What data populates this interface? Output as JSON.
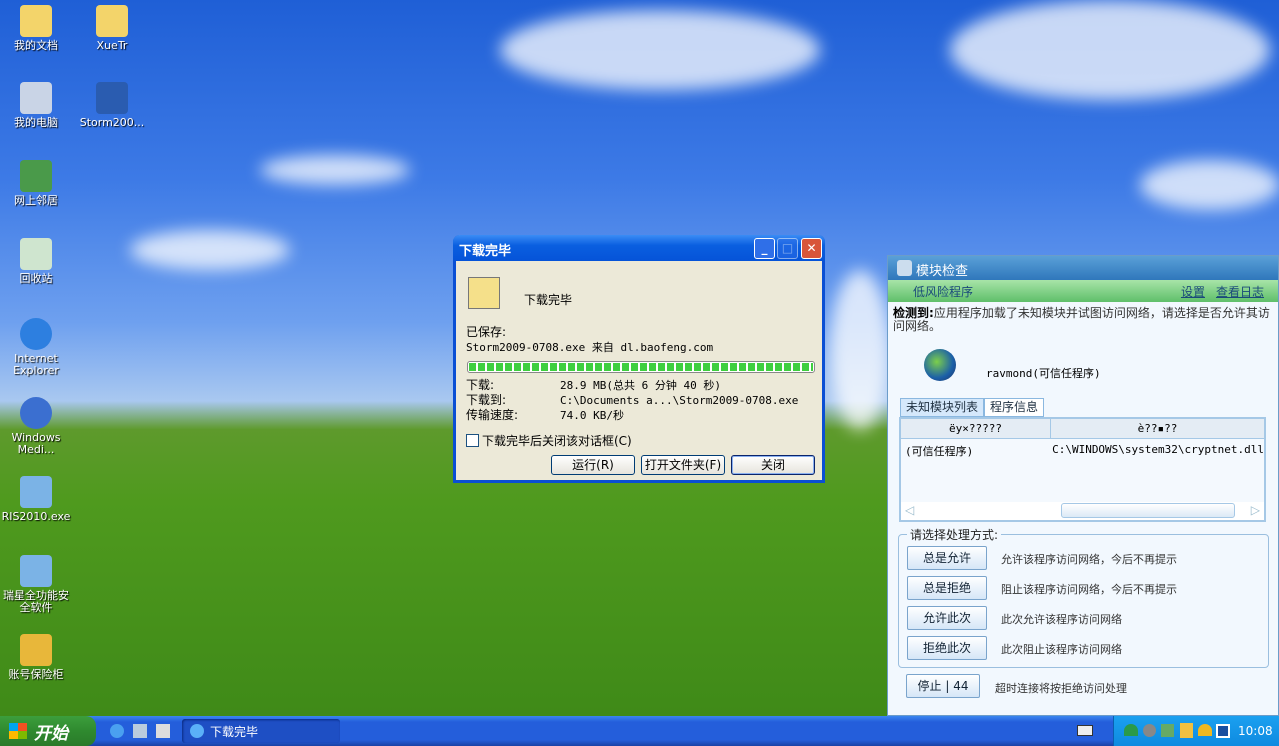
{
  "desktop": {
    "icons": [
      {
        "label": "我的文档"
      },
      {
        "label": "XueTr"
      },
      {
        "label": "我的电脑"
      },
      {
        "label": "Storm200..."
      },
      {
        "label": "网上邻居"
      },
      {
        "label": "回收站"
      },
      {
        "label": "Internet Explorer"
      },
      {
        "label": "Windows Medi..."
      },
      {
        "label": "RIS2010.exe"
      },
      {
        "label": "瑞星全功能安全软件"
      },
      {
        "label": "账号保险柜"
      }
    ]
  },
  "download": {
    "title": "下载完毕",
    "heading": "下载完毕",
    "saved_label": "已保存:",
    "saved_value": "Storm2009-0708.exe 来自 dl.baofeng.com",
    "progress": 100,
    "rows": [
      {
        "k": "下载:",
        "v": "28.9 MB(总共 6 分钟 40 秒)"
      },
      {
        "k": "下载到:",
        "v": "C:\\Documents a...\\Storm2009-0708.exe"
      },
      {
        "k": "传输速度:",
        "v": "74.0 KB/秒"
      }
    ],
    "checkbox": "下载完毕后关闭该对话框(C)",
    "run": "运行(R)",
    "open_folder": "打开文件夹(F)",
    "close": "关闭"
  },
  "module": {
    "title": "模块检查",
    "risk": "低风险程序",
    "settings": "设置",
    "log": "查看日志",
    "detect_label": "检测到:",
    "detect_text": "应用程序加载了未知模块并试图访问网络，请选择是否允许其访问网络。",
    "program": "ravmond(可信任程序)",
    "tabs": [
      "未知模块列表",
      "程序信息"
    ],
    "columns": [
      "ëy×?????",
      "è??▪??"
    ],
    "row": [
      "(可信任程序)",
      "C:\\WINDOWS\\system32\\cryptnet.dll"
    ],
    "choose": "请选择处理方式:",
    "actions": [
      {
        "label": "总是允许",
        "desc": "允许该程序访问网络，今后不再提示"
      },
      {
        "label": "总是拒绝",
        "desc": "阻止该程序访问网络，今后不再提示"
      },
      {
        "label": "允许此次",
        "desc": "此次允许该程序访问网络"
      },
      {
        "label": "拒绝此次",
        "desc": "此次阻止该程序访问网络"
      }
    ],
    "stop": "停止 | 44",
    "timeout": "超时连接将按拒绝访问处理"
  },
  "taskbar": {
    "start": "开始",
    "task": "下载完毕",
    "clock": "10:08"
  }
}
